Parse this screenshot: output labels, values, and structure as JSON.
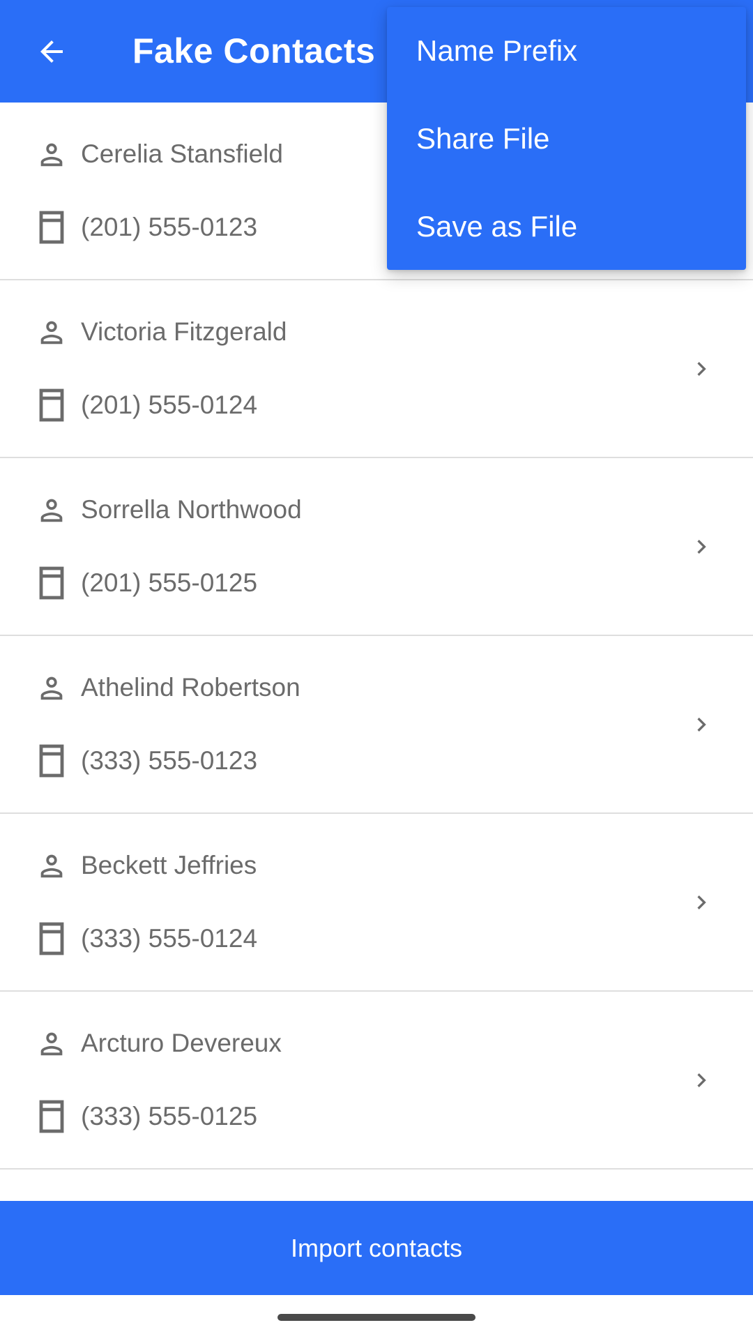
{
  "app_bar": {
    "title": "Fake Contacts",
    "back_icon": "arrow-left-icon",
    "color": "#2A6EF7"
  },
  "contacts": [
    {
      "name": "Cerelia Stansfield",
      "phone": "(201) 555-0123"
    },
    {
      "name": "Victoria Fitzgerald",
      "phone": "(201) 555-0124"
    },
    {
      "name": "Sorrella Northwood",
      "phone": "(201) 555-0125"
    },
    {
      "name": "Athelind Robertson",
      "phone": "(333) 555-0123"
    },
    {
      "name": "Beckett Jeffries",
      "phone": "(333) 555-0124"
    },
    {
      "name": "Arcturo Devereux",
      "phone": "(333) 555-0125"
    }
  ],
  "icons": {
    "person": "person-icon",
    "phone": "phone-icon",
    "chevron": "chevron-right-icon"
  },
  "overflow_menu": {
    "items": [
      {
        "label": "Name Prefix"
      },
      {
        "label": "Share File"
      },
      {
        "label": "Save as File"
      }
    ]
  },
  "footer": {
    "import_label": "Import contacts"
  }
}
